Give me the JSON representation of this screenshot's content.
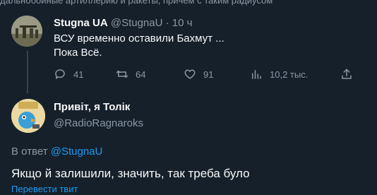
{
  "top_cut_text": "дальнобойные артиллерию и ракеты, причем с таким радиусом",
  "tweet": {
    "author_name": "Stugna UA",
    "author_handle": "@StugnaU",
    "separator": "·",
    "time": "10 ч",
    "text_line1": "ВСУ временно оставили Бахмут ...",
    "text_line2": "Пока Всё.",
    "actions": {
      "replies": "41",
      "retweets": "64",
      "likes": "91",
      "views": "10,2 тыс."
    }
  },
  "reply": {
    "author_name": "Привіт, я Толік",
    "author_handle": "@RadioRagnaroks",
    "in_reply_prefix": "В ответ",
    "in_reply_handle": "@StugnaU",
    "text": "Якщо й залишили, значить, так треба було",
    "translate_label": "Перевести твит"
  },
  "colors": {
    "background": "#15202b",
    "primary_text": "#f7f9f9",
    "secondary_text": "#8b98a5",
    "accent": "#1d9bf0"
  },
  "icons": [
    "reply-icon",
    "retweet-icon",
    "like-icon",
    "views-icon",
    "share-icon"
  ]
}
